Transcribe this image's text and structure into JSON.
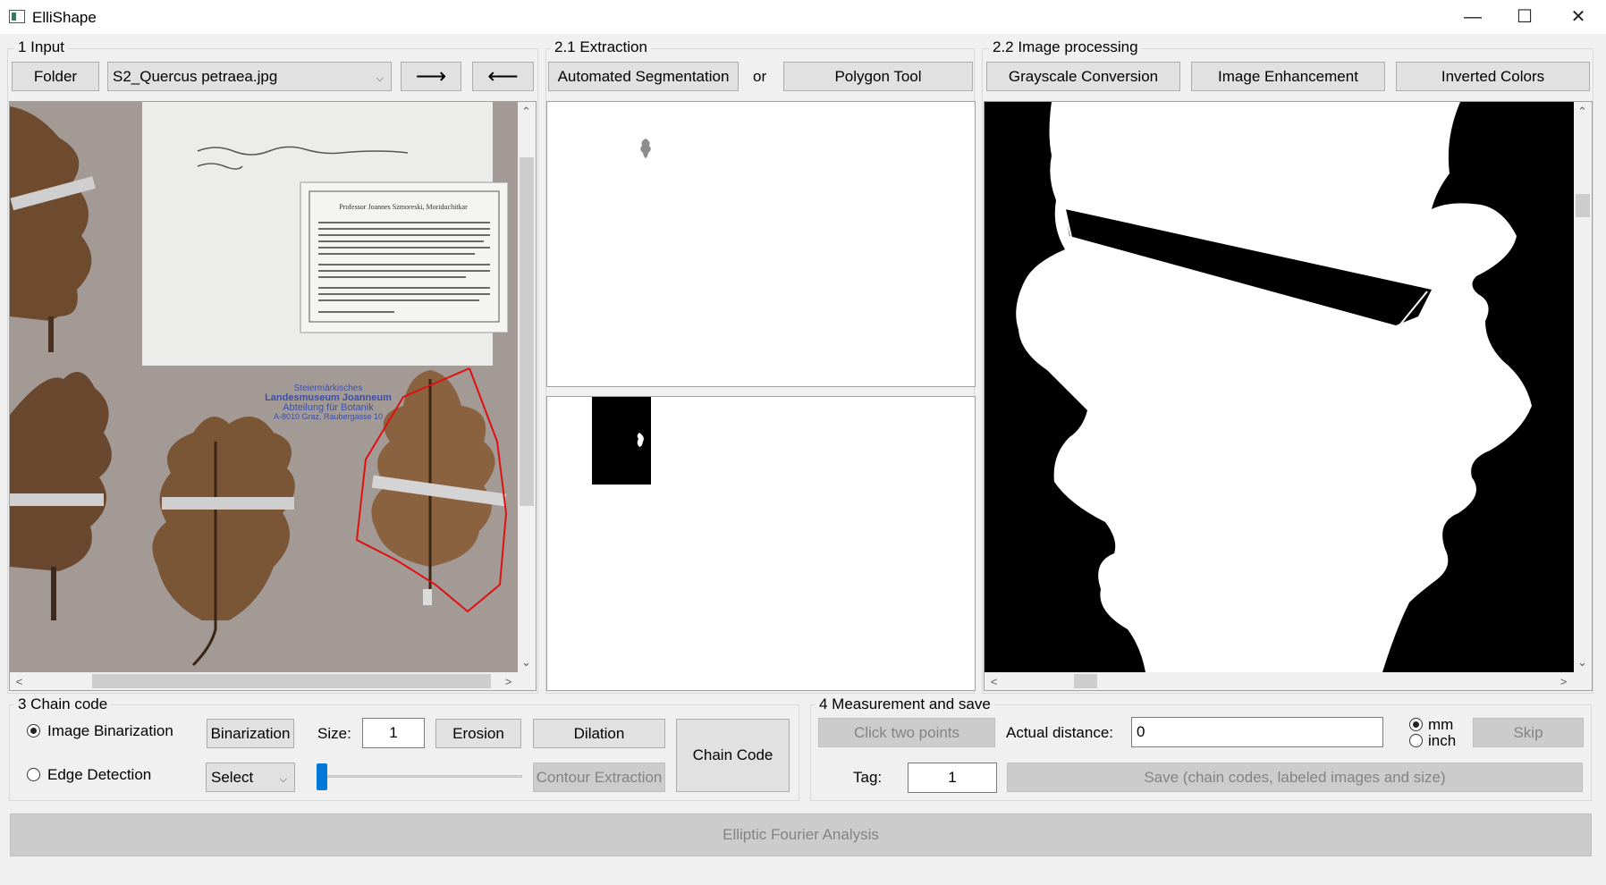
{
  "window": {
    "title": "ElliShape",
    "minimize": "—",
    "maximize": "☐",
    "close": "✕"
  },
  "input": {
    "group_title": "1 Input",
    "folder_label": "Folder",
    "file_selected": "S2_Quercus petraea.jpg",
    "next_arrow": "⟶",
    "prev_arrow": "⟵"
  },
  "extraction": {
    "group_title": "2.1 Extraction",
    "auto_seg_label": "Automated Segmentation",
    "or_label": "or",
    "polygon_label": "Polygon Tool"
  },
  "processing": {
    "group_title": "2.2 Image processing",
    "grayscale_label": "Grayscale Conversion",
    "enhance_label": "Image Enhancement",
    "invert_label": "Inverted Colors"
  },
  "herbarium": {
    "label_lines": [
      "Professor Joannes Szmoreski, Moriduchitkar"
    ],
    "stamp_lines": [
      "Steiermärkisches",
      "Landesmuseum Joanneum",
      "Abteilung für Botanik",
      "A-8010 Graz, Raubergasse 10"
    ]
  },
  "chain_code": {
    "group_title": "3 Chain code",
    "binarization_radio": "Image Binarization",
    "edge_radio": "Edge Detection",
    "binarization_button": "Binarization",
    "size_label": "Size:",
    "size_value": "1",
    "erosion_label": "Erosion",
    "dilation_label": "Dilation",
    "select_value": "Select",
    "contour_label": "Contour Extraction",
    "chain_code_label": "Chain Code",
    "slider_value": 0
  },
  "measurement": {
    "group_title": "4 Measurement and save",
    "click_points_label": "Click two points",
    "actual_distance_label": "Actual distance:",
    "actual_distance_value": "0",
    "unit_mm": "mm",
    "unit_inch": "inch",
    "skip_label": "Skip",
    "tag_label": "Tag:",
    "tag_value": "1",
    "save_label": "Save (chain codes, labeled images and size)"
  },
  "efa_label": "Elliptic Fourier Analysis",
  "icons": [
    "app-icon",
    "minimize-icon",
    "maximize-icon",
    "close-icon",
    "chevron-down-icon",
    "scroll-up-icon",
    "scroll-down-icon",
    "scroll-left-icon",
    "scroll-right-icon"
  ]
}
